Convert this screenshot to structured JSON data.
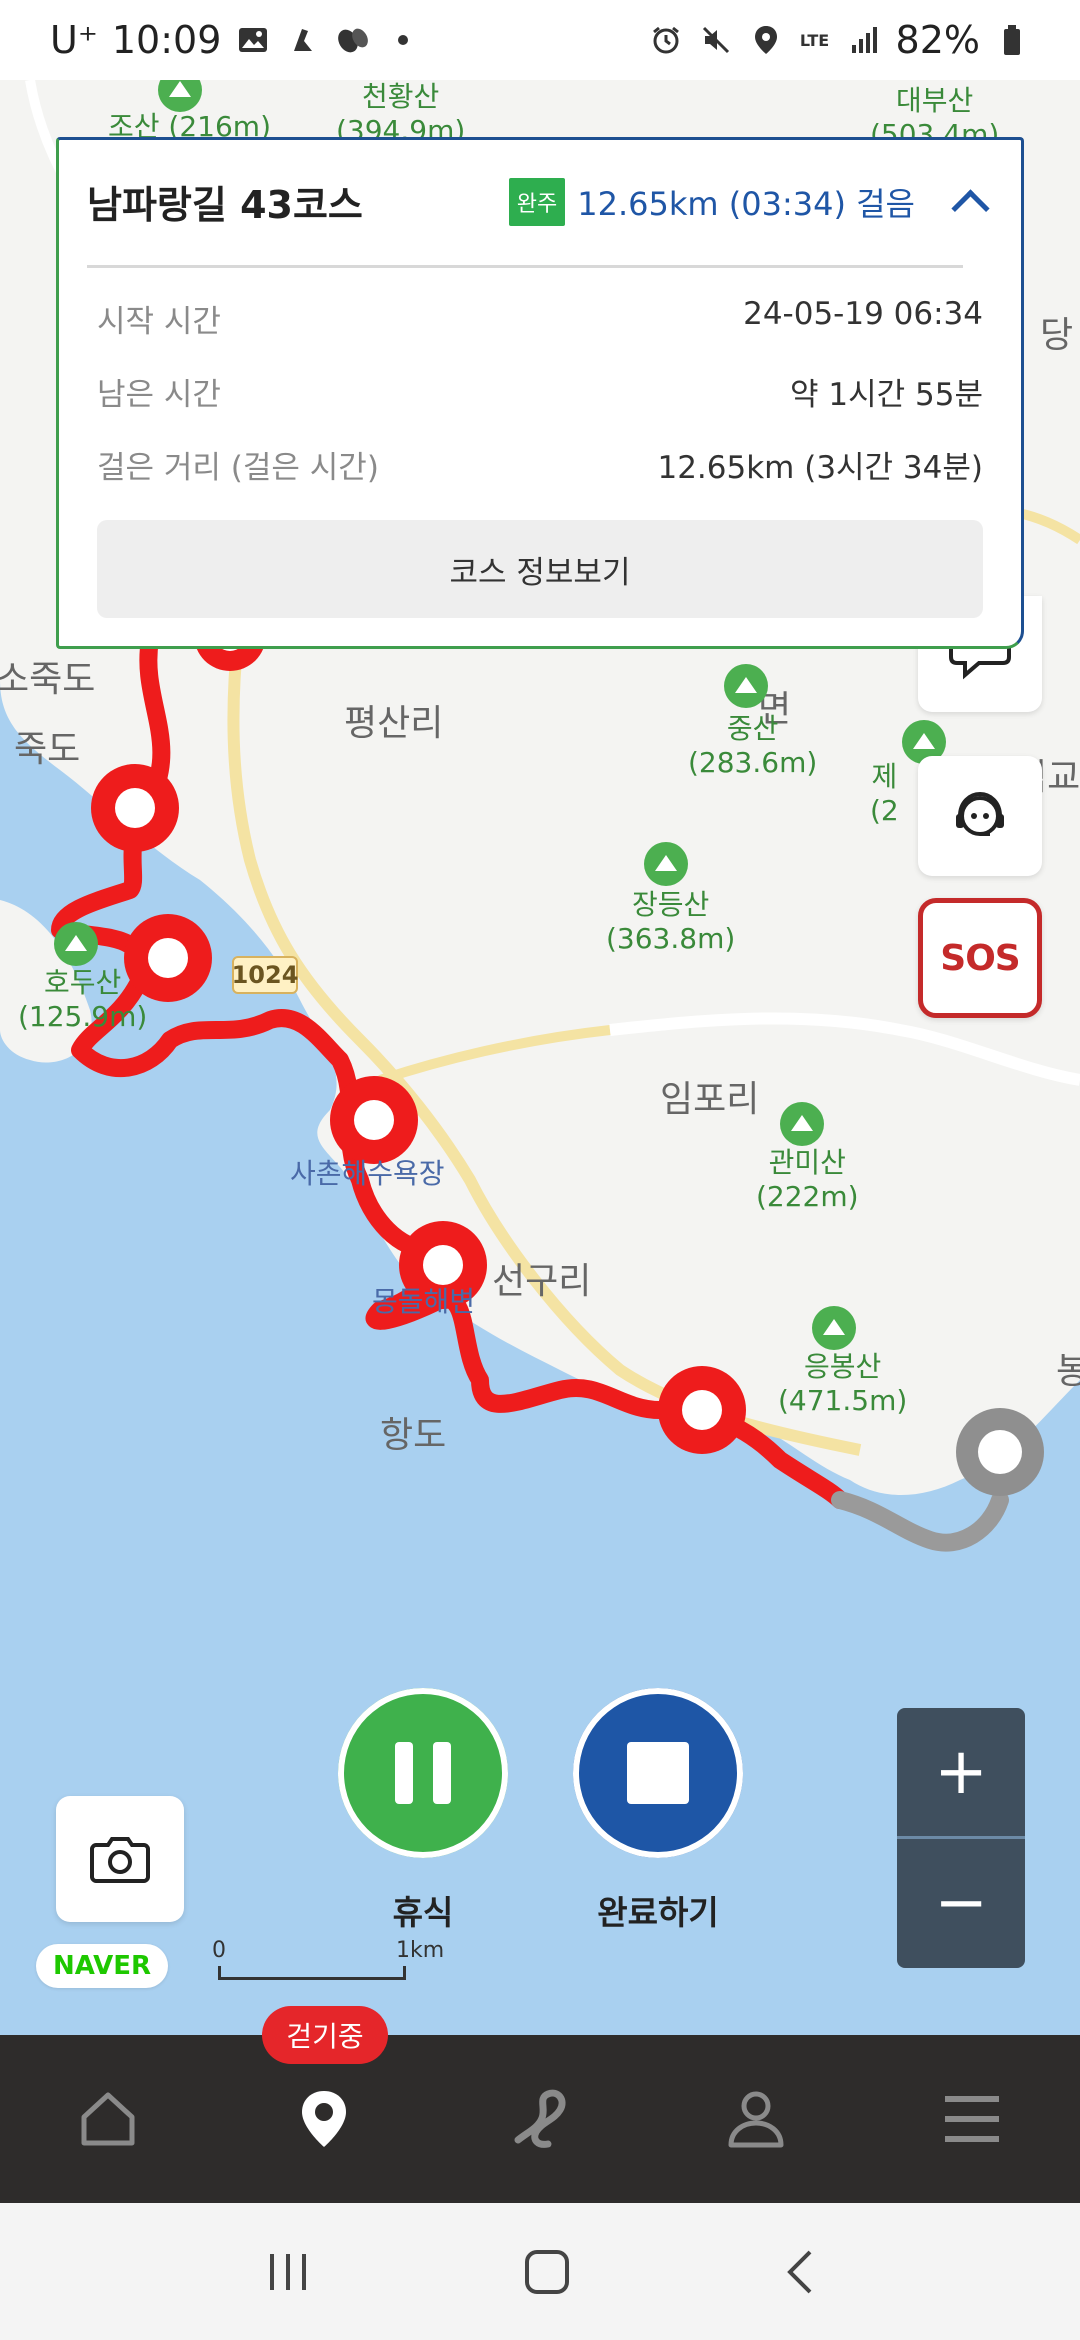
{
  "status_bar": {
    "carrier": "U⁺",
    "time": "10:09",
    "battery": "82%",
    "icons": [
      "gallery-icon",
      "hiking-icon",
      "footprint-icon",
      "dot-icon",
      "alarm-icon",
      "mute-icon",
      "location-icon",
      "lte-icon",
      "signal-icon",
      "battery-icon"
    ]
  },
  "map": {
    "place_labels": {
      "jangdeungsan": "장등산\n(363.8m)",
      "pyeongsan": "평산리",
      "impo": "임포리",
      "sachon": "사촌해수욕장",
      "seongu": "선구리",
      "hangdo": "항도",
      "hodusan": "호두산\n(125.9m)",
      "jungsan": "중산\n(283.6m)",
      "gwanmisan": "관미산\n(222m)",
      "eungbongsan": "응봉산\n(471.5m)",
      "sojukdo": "소죽도",
      "jukdo": "죽도",
      "josan": "조산 (216m)",
      "cheonhwangsan": "천황산\n(394.9m)",
      "daebusan": "대부산\n(503.4m)",
      "mongdol": "몽돌해변",
      "myeon": "면",
      "dang": "당",
      "seokgyo": "석교",
      "bong": "봉",
      "je": "제\n(2"
    },
    "route_number": "1024",
    "colors": {
      "route_walked": "#ee1c1c",
      "route_remaining": "#9a9a9a",
      "sea": "#a9d0f0",
      "land": "#f4f4f2"
    }
  },
  "card": {
    "title": "남파랑길 43코스",
    "status": "완주",
    "summary": "12.65km (03:34) 걸음",
    "rows": [
      {
        "label": "시작 시간",
        "value": "24-05-19 06:34"
      },
      {
        "label": "남은 시간",
        "value": "약 1시간 55분"
      },
      {
        "label": "걸은 거리 (걸은 시간)",
        "value": "12.65km (3시간 34분)"
      }
    ],
    "course_button": "코스 정보보기"
  },
  "controls": {
    "rest_label": "휴식",
    "finish_label": "완료하기",
    "sos_label": "SOS",
    "zoom_in": "+",
    "zoom_out": "−",
    "naver": "NAVER",
    "scale_zero": "0",
    "scale_km": "1km"
  },
  "bottom_nav": {
    "active_badge": "걷기중",
    "items": [
      "home-icon",
      "location-pin-icon",
      "route-icon",
      "profile-icon",
      "menu-icon"
    ]
  }
}
